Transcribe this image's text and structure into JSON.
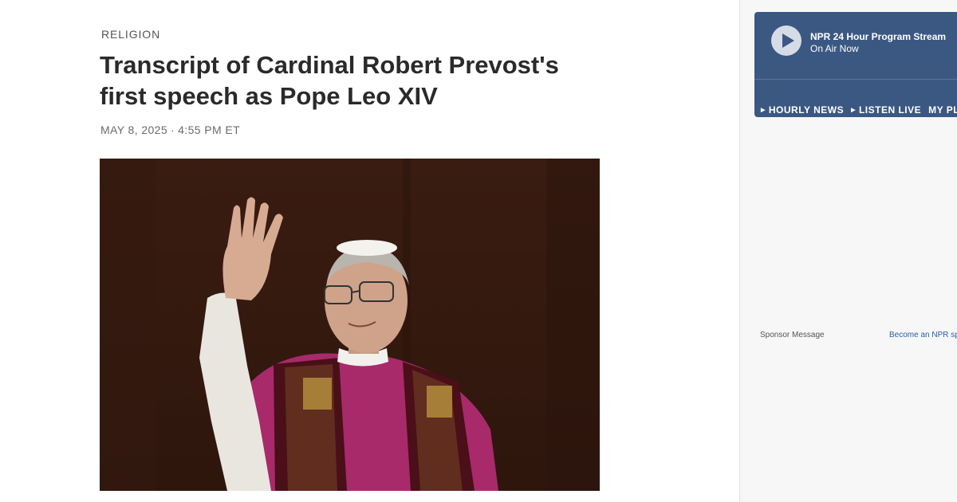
{
  "article": {
    "section": "RELIGION",
    "headline": "Transcript of Cardinal Robert Prevost's first speech as Pope Leo XIV",
    "date": "MAY 8, 2025",
    "time": "4:55 PM ET",
    "separator": "·"
  },
  "player": {
    "stream_title": "NPR 24 Hour Program Stream",
    "status": "On Air Now",
    "links": [
      {
        "label": "HOURLY NEWS"
      },
      {
        "label": "LISTEN LIVE"
      },
      {
        "label": "MY PLAYLIST"
      }
    ],
    "play_icon": "play-icon",
    "bg_color": "#3b5883"
  },
  "sidebar": {
    "sponsor_label": "Sponsor Message",
    "become_link": "Become an NPR sponsor"
  }
}
